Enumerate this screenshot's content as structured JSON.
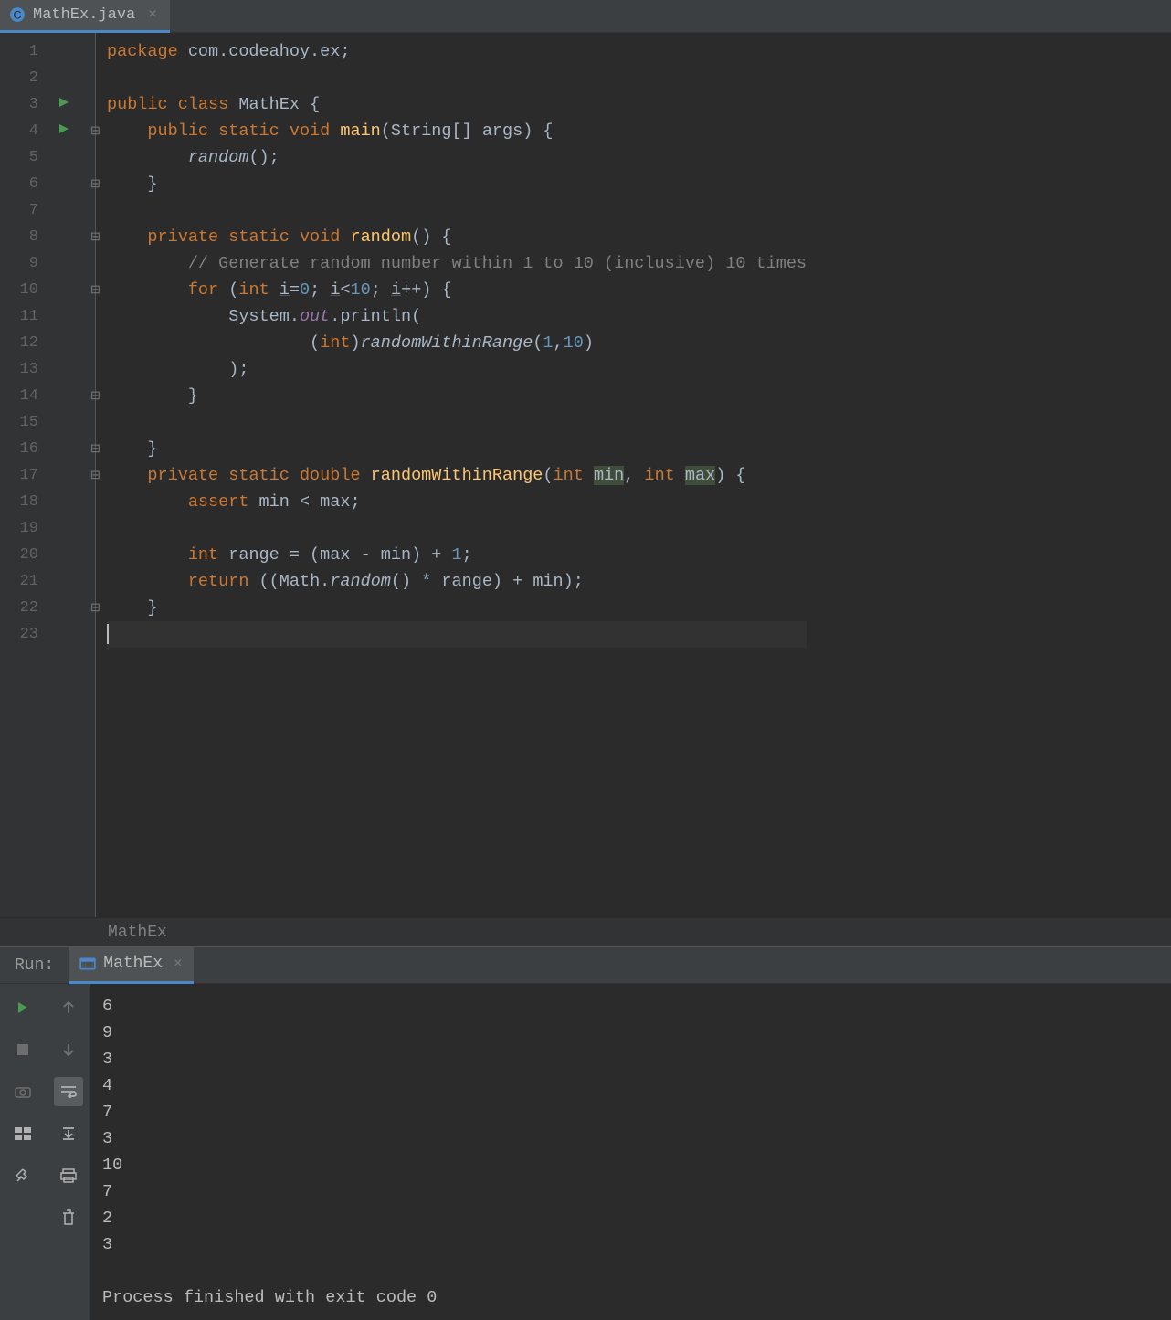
{
  "tab": {
    "filename": "MathEx.java"
  },
  "breadcrumb": "MathEx",
  "code": {
    "lines": [
      {
        "n": 1,
        "run": false,
        "fold": "",
        "html": "<span class='kw'>package</span> com.codeahoy.ex;"
      },
      {
        "n": 2,
        "run": false,
        "fold": "",
        "html": ""
      },
      {
        "n": 3,
        "run": true,
        "fold": "",
        "html": "<span class='kw'>public class</span> <span class='cls'>MathEx</span> {"
      },
      {
        "n": 4,
        "run": true,
        "fold": "-",
        "html": "    <span class='kw'>public static void</span> <span class='method-decl'>main</span>(String[] args) {"
      },
      {
        "n": 5,
        "run": false,
        "fold": "",
        "html": "        <span class='call-italic'>random</span>();"
      },
      {
        "n": 6,
        "run": false,
        "fold": "-",
        "html": "    }"
      },
      {
        "n": 7,
        "run": false,
        "fold": "",
        "html": ""
      },
      {
        "n": 8,
        "run": false,
        "fold": "-",
        "html": "    <span class='kw'>private static void</span> <span class='method-decl'>random</span>() {"
      },
      {
        "n": 9,
        "run": false,
        "fold": "",
        "html": "        <span class='comment'>// Generate random number within 1 to 10 (inclusive) 10 times</span>"
      },
      {
        "n": 10,
        "run": false,
        "fold": "-",
        "html": "        <span class='kw'>for</span> (<span class='kw'>int</span> <span class='var-under'>i</span>=<span class='num'>0</span>; <span class='var-under'>i</span>&lt;<span class='num'>10</span>; <span class='var-under'>i</span>++) {"
      },
      {
        "n": 11,
        "run": false,
        "fold": "",
        "html": "            System.<span class='field-italic'>out</span>.println("
      },
      {
        "n": 12,
        "run": false,
        "fold": "",
        "html": "                    (<span class='kw'>int</span>)<span class='call-italic'>randomWithinRange</span>(<span class='num'>1</span>,<span class='num'>10</span>)"
      },
      {
        "n": 13,
        "run": false,
        "fold": "",
        "html": "            );"
      },
      {
        "n": 14,
        "run": false,
        "fold": "-",
        "html": "        }"
      },
      {
        "n": 15,
        "run": false,
        "fold": "",
        "html": ""
      },
      {
        "n": 16,
        "run": false,
        "fold": "-",
        "html": "    }"
      },
      {
        "n": 17,
        "run": false,
        "fold": "-",
        "html": "    <span class='kw'>private static double</span> <span class='method-decl'>randomWithinRange</span>(<span class='kw'>int</span> <span class='hl-param'>min</span>, <span class='kw'>int</span> <span class='hl-param'>max</span>) {"
      },
      {
        "n": 18,
        "run": false,
        "fold": "",
        "html": "        <span class='kw'>assert</span> min &lt; max;"
      },
      {
        "n": 19,
        "run": false,
        "fold": "",
        "html": ""
      },
      {
        "n": 20,
        "run": false,
        "fold": "",
        "html": "        <span class='kw'>int</span> range = (max - min) + <span class='num'>1</span>;"
      },
      {
        "n": 21,
        "run": false,
        "fold": "",
        "html": "        <span class='kw'>return</span> ((Math.<span class='call-italic'>random</span>() * range) + min);"
      },
      {
        "n": 22,
        "run": false,
        "fold": "-",
        "html": "    }"
      },
      {
        "n": 23,
        "run": false,
        "fold": "",
        "html": "<span class='caret'></span>",
        "current": true
      }
    ]
  },
  "run": {
    "header_label": "Run:",
    "config_name": "MathEx",
    "output_lines": [
      "6",
      "9",
      "3",
      "4",
      "7",
      "3",
      "10",
      "7",
      "2",
      "3",
      "",
      "Process finished with exit code 0"
    ]
  },
  "icons": {
    "run_toolbar_left": [
      "run",
      "stop",
      "camera",
      "layout",
      "pin"
    ],
    "run_toolbar_right": [
      "up",
      "down",
      "wrap",
      "download",
      "print",
      "trash"
    ]
  }
}
